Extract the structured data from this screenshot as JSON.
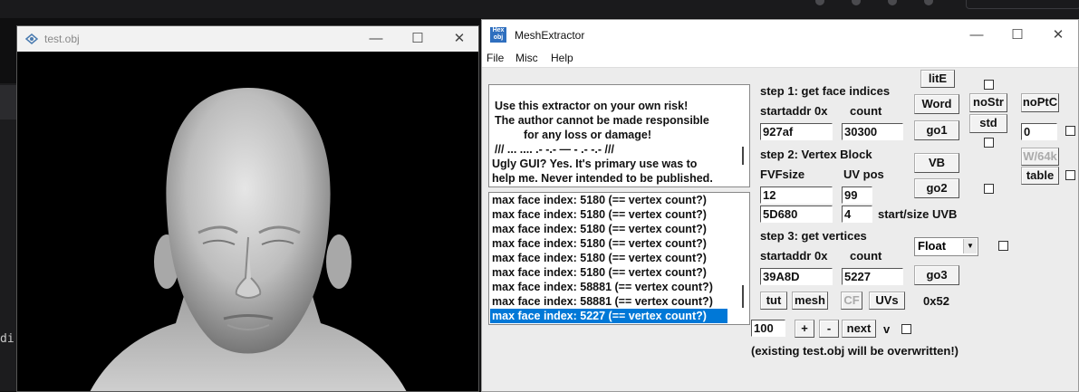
{
  "viewer": {
    "title": "test.obj",
    "icon": "mesh-logo-icon",
    "controls": {
      "minimize": "—",
      "maximize": "☐",
      "close": "✕"
    }
  },
  "background": {
    "partial_text": "di"
  },
  "mesh_window": {
    "title": "MeshExtractor",
    "logo": {
      "line1": "Hex",
      "line2": "obj"
    },
    "controls": {
      "minimize": "—",
      "maximize": "☐",
      "close": "✕"
    },
    "menu": [
      "File",
      "Misc",
      "Help"
    ]
  },
  "message": {
    "lines": [
      "Use this extractor on your own risk!",
      "The author cannot be made responsible",
      "for any loss or damage!",
      "/// ... .... .- -.- — - .- -.- ///",
      "Ugly GUI? Yes. It's primary use was to",
      "help me. Never intended to be published."
    ]
  },
  "log": {
    "items": [
      "max face index: 5180 (== vertex count?)",
      "max face index: 5180 (== vertex count?)",
      "max face index: 5180 (== vertex count?)",
      "max face index: 5180 (== vertex count?)",
      "max face index: 5180 (== vertex count?)",
      "max face index: 5180 (== vertex count?)",
      "max face index: 58881 (== vertex count?)",
      "max face index: 58881 (== vertex count?)",
      "max face index: 5227 (== vertex count?)"
    ],
    "selected_index": 8
  },
  "step1": {
    "label": "step 1: get face indices",
    "startaddr_label": "startaddr 0x",
    "count_label": "count",
    "startaddr_value": "927af",
    "count_value": "30300",
    "go_button": "go1"
  },
  "step2": {
    "label": "step 2: Vertex Block",
    "fvf_label": "FVFsize",
    "uvpos_label": "UV pos",
    "fvf_value": "12",
    "uvpos_value": "99",
    "uvb_start_value": "5D680",
    "uvb_size_value": "4",
    "uvb_label": "start/size UVB",
    "vb_button": "VB",
    "go_button": "go2"
  },
  "step3": {
    "label": "step 3: get vertices",
    "startaddr_label": "startaddr 0x",
    "count_label": "count",
    "startaddr_value": "39A8D",
    "count_value": "5227",
    "go_button": "go3",
    "format_value": "Float"
  },
  "buttons": {
    "lite": "litE",
    "word": "Word",
    "nostr": "noStr",
    "noptc": "noPtC",
    "std": "std",
    "w64k": "W/64k",
    "table": "table",
    "tut": "tut",
    "mesh": "mesh",
    "cf": "CF",
    "uvs": "UVs",
    "plus": "+",
    "minus": "-",
    "next": "next"
  },
  "misc": {
    "ptc_value": "0",
    "hex_readout": "0x52",
    "step_value": "100",
    "v_label": "v",
    "overwrite_note": "(existing test.obj will be overwritten!)"
  }
}
